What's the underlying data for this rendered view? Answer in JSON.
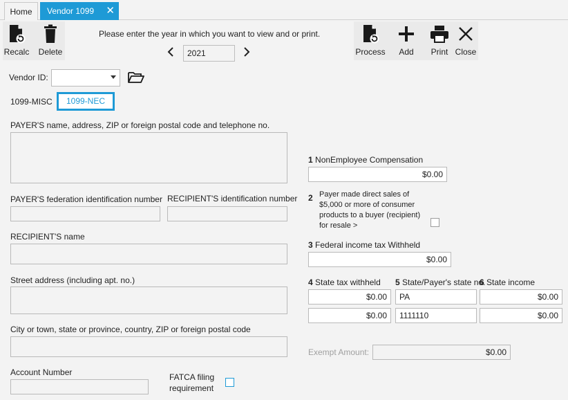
{
  "tabs": {
    "home": "Home",
    "vendor": "Vendor 1099",
    "close_glyph": "✕"
  },
  "toolbar": {
    "recalc": "Recalc",
    "delete": "Delete",
    "process": "Process",
    "add": "Add",
    "print": "Print",
    "close": "Close",
    "prompt": "Please enter the year in which you want to view and or print.",
    "year": "2021"
  },
  "vendor": {
    "label": "Vendor ID:",
    "value": ""
  },
  "subtabs": {
    "misc": "1099-MISC",
    "nec": "1099-NEC"
  },
  "form": {
    "payer_label": "PAYER'S name, address, ZIP or foreign postal code and telephone no.",
    "payer_fed_id_label": "PAYER'S federation identification number",
    "recipient_id_label": "RECIPIENT'S identification number",
    "recipient_name_label": "RECIPIENT'S name",
    "street_label": "Street address (including apt. no.)",
    "city_label": "City or town, state or province, country, ZIP or foreign postal code",
    "account_label": "Account Number",
    "fatca_line1": "FATCA filing",
    "fatca_line2": "requirement",
    "box1_num": "1",
    "box1_label": "NonEmployee Compensation",
    "box1_value": "$0.00",
    "box2_num": "2",
    "box2_line1": "Payer made direct sales of",
    "box2_line2": "$5,000 or more of consumer",
    "box2_line3": "products to a buyer (recipient)",
    "box2_line4": "for resale >",
    "box3_num": "3",
    "box3_label": "Federal income tax Withheld",
    "box3_value": "$0.00",
    "box4_num": "4",
    "box4_label": "State tax withheld",
    "box5_num": "5",
    "box5_label": "State/Payer's state no.",
    "box6_num": "6",
    "box6_label": "State income",
    "state_rows": [
      {
        "tax": "$0.00",
        "state": "PA",
        "income": "$0.00"
      },
      {
        "tax": "$0.00",
        "state": "1111110",
        "income": "$0.00"
      }
    ],
    "exempt_label": "Exempt Amount:",
    "exempt_value": "$0.00"
  },
  "colors": {
    "accent": "#1e9ad6"
  }
}
